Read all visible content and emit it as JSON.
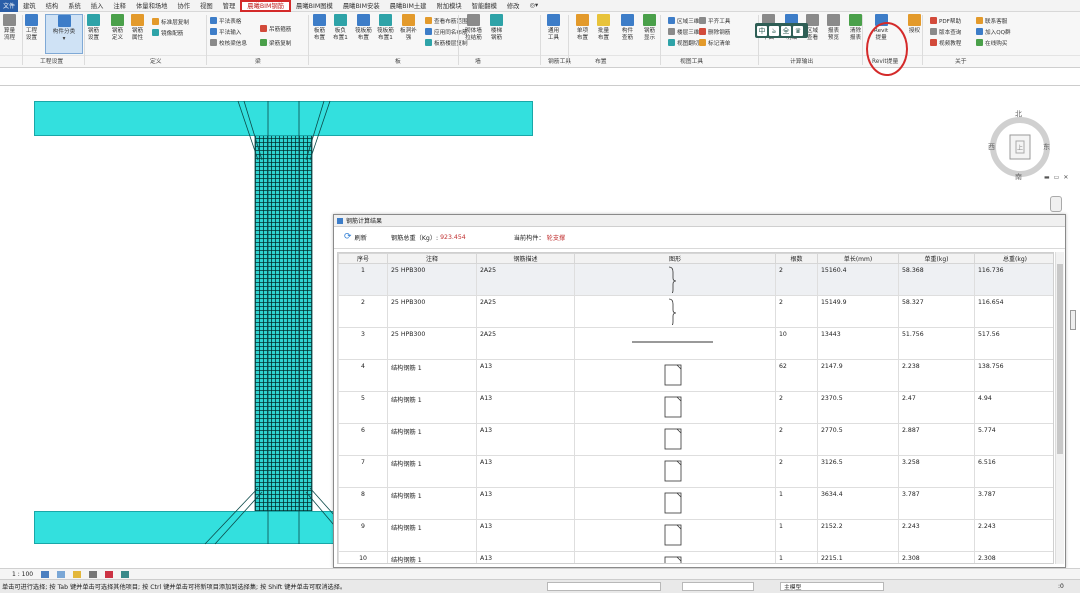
{
  "menubar": {
    "file": "文件",
    "tabs": [
      "建筑",
      "结构",
      "系统",
      "插入",
      "注释",
      "体量和场地",
      "协作",
      "视图",
      "管理",
      "晨曦BIM钢筋",
      "晨曦BIM图模",
      "晨曦BIM安装",
      "晨曦BIM土建",
      "附加模块",
      "智能翻模",
      "修改",
      "◎▾"
    ],
    "active_tab": "晨曦BIM钢筋",
    "accent": "#d42a2a"
  },
  "ribbon": {
    "buttons": {
      "b0": "算量\n流程",
      "b1": "工程\n设置",
      "b2": "构件分类",
      "b3": "钢筋\n设置",
      "b4": "钢筋\n定义",
      "b5": "钢筋\n属性",
      "b6": "板筋\n布置",
      "b7": "板负\n布置1",
      "b8": "筏板筋\n布置",
      "b9": "筏板筋\n布置1",
      "b10": "板洞补\n强",
      "b11": "砌体墙\n拉结筋",
      "b12": "楼梯\n钢筋",
      "b13": "通用\n工具",
      "b14": "单项\n布置",
      "b15": "批量\n布置",
      "b16": "构件\n查筋",
      "b17": "钢筋\n显示",
      "b18": "节点\n平面",
      "b19": "钢筋\n明细",
      "b20": "区域\n查看",
      "b21": "报表\n预览",
      "b22": "清除\n报表",
      "b23": "Revit\n提量",
      "b24": "授权"
    },
    "small": {
      "s0": "标准层复制",
      "s1": "镜像配筋",
      "s2": "平法表格",
      "s3": "平法输入",
      "s4": "校核梁信息",
      "s5": "吊筋箍筋",
      "s6": "梁筋复制",
      "s7": "查看布筋范围",
      "s8": "应用同名布筋",
      "s9": "板筋楼层复制",
      "s10": "区域三维",
      "s11": "楼层三维",
      "s12": "视图翻切",
      "s13": "平齐工具",
      "s14": "删除钢筋",
      "s15": "标记清单",
      "s16": "PDF帮助",
      "s17": "版本查询",
      "s18": "视频教程",
      "s19": "联系客服",
      "s20": "加入QQ群",
      "s21": "在线购买"
    },
    "groups": [
      "工程设置",
      "定义",
      "梁",
      "板",
      "墙",
      "钢筋工具",
      "布置",
      "视图工具",
      "计算输出",
      "Revit提量",
      "关于"
    ]
  },
  "float_toolbar": [
    "中",
    "ঌ",
    "全",
    "♛"
  ],
  "viewcube": {
    "top": "北",
    "right": "东",
    "bottom": "南",
    "left": "西",
    "face": "上"
  },
  "rebar_window": {
    "title": "钢筋计算结果",
    "refresh": "刷新",
    "weight_label": "钢筋总重（Kg）:",
    "weight_value": "923.454",
    "component_label": "当前构件：",
    "component_value": "轮支撑",
    "columns": [
      "序号",
      "注释",
      "钢筋描述",
      "图形",
      "根数",
      "单长(mm)",
      "单重(kg)",
      "总重(kg)"
    ],
    "rows": [
      {
        "no": "1",
        "note": "25 HPB300",
        "desc": "2A25",
        "shape": "brace",
        "count": "2",
        "len": "15160.4",
        "unit": "58.368",
        "total": "116.736"
      },
      {
        "no": "2",
        "note": "25 HPB300",
        "desc": "2A25",
        "shape": "brace",
        "count": "2",
        "len": "15149.9",
        "unit": "58.327",
        "total": "116.654"
      },
      {
        "no": "3",
        "note": "25 HPB300",
        "desc": "2A25",
        "shape": "line",
        "count": "10",
        "len": "13443",
        "unit": "51.756",
        "total": "517.56"
      },
      {
        "no": "4",
        "note": "结构钢筋 1",
        "desc": "A13",
        "shape": "stirrup",
        "count": "62",
        "len": "2147.9",
        "unit": "2.238",
        "total": "138.756"
      },
      {
        "no": "5",
        "note": "结构钢筋 1",
        "desc": "A13",
        "shape": "stirrup",
        "count": "2",
        "len": "2370.5",
        "unit": "2.47",
        "total": "4.94"
      },
      {
        "no": "6",
        "note": "结构钢筋 1",
        "desc": "A13",
        "shape": "stirrup",
        "count": "2",
        "len": "2770.5",
        "unit": "2.887",
        "total": "5.774"
      },
      {
        "no": "7",
        "note": "结构钢筋 1",
        "desc": "A13",
        "shape": "stirrup",
        "count": "2",
        "len": "3126.5",
        "unit": "3.258",
        "total": "6.516"
      },
      {
        "no": "8",
        "note": "结构钢筋 1",
        "desc": "A13",
        "shape": "stirrup",
        "count": "1",
        "len": "3634.4",
        "unit": "3.787",
        "total": "3.787"
      },
      {
        "no": "9",
        "note": "结构钢筋 1",
        "desc": "A13",
        "shape": "stirrup",
        "count": "1",
        "len": "2152.2",
        "unit": "2.243",
        "total": "2.243"
      },
      {
        "no": "10",
        "note": "结构钢筋 1",
        "desc": "A13",
        "shape": "stirrup",
        "count": "1",
        "len": "2215.1",
        "unit": "2.308",
        "total": "2.308"
      }
    ]
  },
  "view_control": {
    "scale": "1 : 100"
  },
  "statusbar": {
    "hint": "单击可进行选择; 按 Tab 键并单击可选择其他项目; 按 Ctrl 键并单击可将新项目添加到选择集; 按 Shift 键并单击可取消选择。",
    "model_dropdown": "主模型",
    "filter_count": ":0"
  },
  "colors": {
    "concrete": "#33e0de",
    "rebar": "#0c3f40"
  }
}
